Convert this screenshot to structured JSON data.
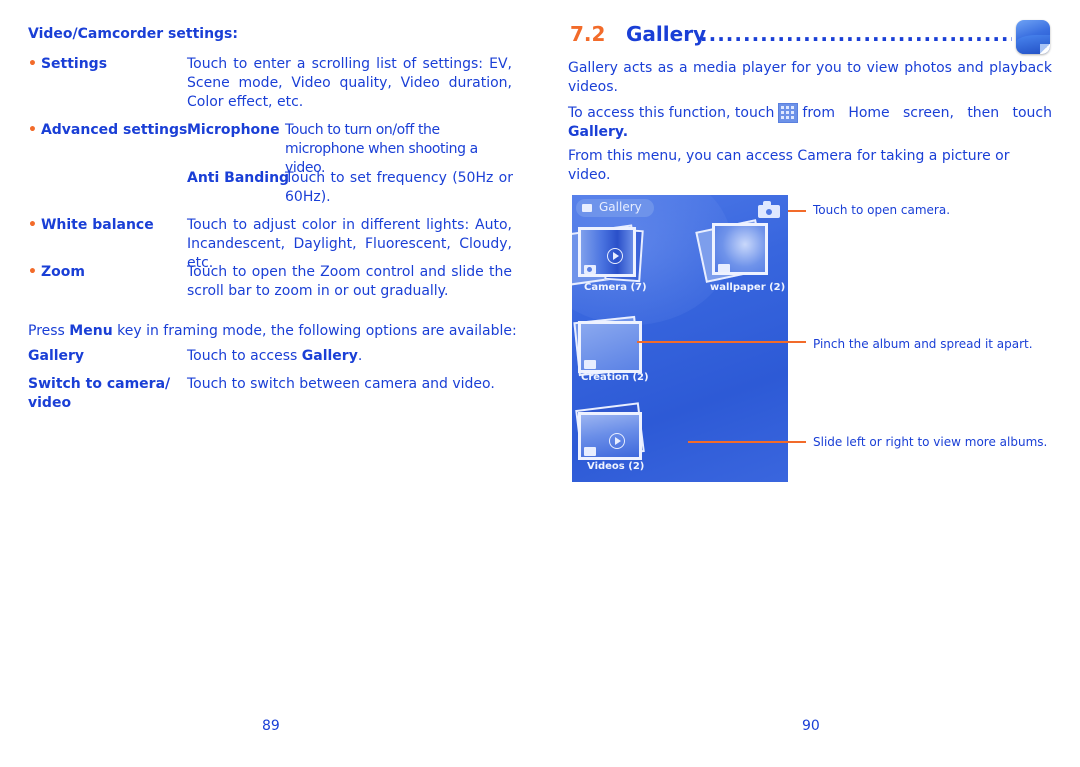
{
  "left_page": {
    "heading": "Video/Camcorder settings:",
    "settings": [
      {
        "term": "Settings",
        "description": "Touch to enter a scrolling list of settings: EV, Scene mode, Video quality, Video duration, Color effect, etc."
      },
      {
        "term": "Advanced settings",
        "sub_items": [
          {
            "term": "Microphone",
            "description": "Touch to turn on/off the microphone when shooting a video."
          },
          {
            "term": "Anti Banding",
            "description": "Touch to set frequency (50Hz or 60Hz)."
          }
        ]
      },
      {
        "term": "White balance",
        "description": "Touch to adjust color in different lights: Auto, Incandescent, Daylight, Fluorescent, Cloudy, etc."
      },
      {
        "term": "Zoom",
        "description": "Touch to open the Zoom control and slide the scroll bar to zoom in or out gradually."
      }
    ],
    "menu_intro": {
      "prefix": "Press ",
      "key": "Menu",
      "suffix": " key in framing mode, the following options are available:"
    },
    "menu_options": [
      {
        "term": "Gallery",
        "description_prefix": "Touch to access ",
        "description_bold": "Gallery",
        "description_suffix": "."
      },
      {
        "term_line1": "Switch to camera/",
        "term_line2": "video",
        "description": "Touch to switch between camera and video."
      }
    ],
    "page_number": "89"
  },
  "right_page": {
    "section_number": "7.2",
    "section_title": "Gallery",
    "section_icon": "gallery-app-icon",
    "intro": "Gallery acts as a media player for you to view photos and playback videos.",
    "access": {
      "prefix": "To access this function, touch",
      "icon": "app-grid-icon",
      "middle": "from Home screen, then touch",
      "bold": "Gallery."
    },
    "camera_note": "From this menu, you can access Camera for taking a picture or video.",
    "screenshot": {
      "header_label": "Gallery",
      "albums": [
        {
          "name": "Camera",
          "count": "(7)"
        },
        {
          "name": "wallpaper",
          "count": "(2)"
        },
        {
          "name": "Creation",
          "count": "(2)"
        },
        {
          "name": "Videos",
          "count": "(2)"
        }
      ]
    },
    "callouts": [
      "Touch to open camera.",
      "Pinch the album and spread it apart.",
      "Slide left or right to view more albums."
    ],
    "page_number": "90"
  },
  "colors": {
    "text_blue": "#1a3fd6",
    "accent_orange": "#f26b2a",
    "screen_blue": "#3866de"
  }
}
